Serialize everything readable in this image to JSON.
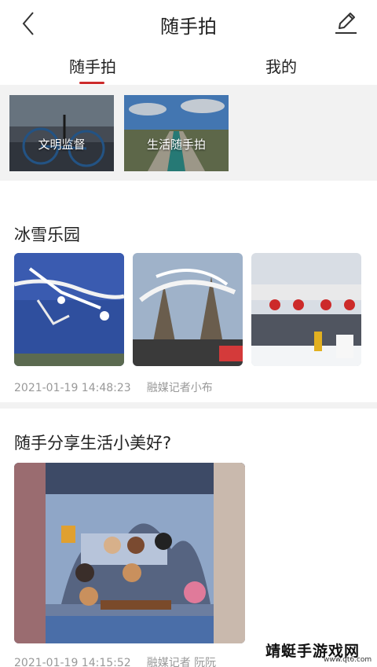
{
  "header": {
    "title": "随手拍",
    "back_icon": "back-chevron-icon",
    "edit_icon": "pen-edit-icon"
  },
  "tabs": [
    {
      "label": "随手拍",
      "active": true
    },
    {
      "label": "我的",
      "active": false
    }
  ],
  "accent_color": "#cc2a2a",
  "categories": [
    {
      "label": "文明监督"
    },
    {
      "label": "生活随手拍"
    }
  ],
  "posts": [
    {
      "title": "冰雪乐园",
      "datetime": "2021-01-19 14:48:23",
      "author": "融媒记者小布"
    },
    {
      "title": "随手分享生活小美好?",
      "datetime": "2021-01-19 14:15:52",
      "author": "融媒记者 阮阮"
    }
  ],
  "watermark": {
    "text": "靖蜓手游戏网",
    "url": "www.qt6.com"
  }
}
